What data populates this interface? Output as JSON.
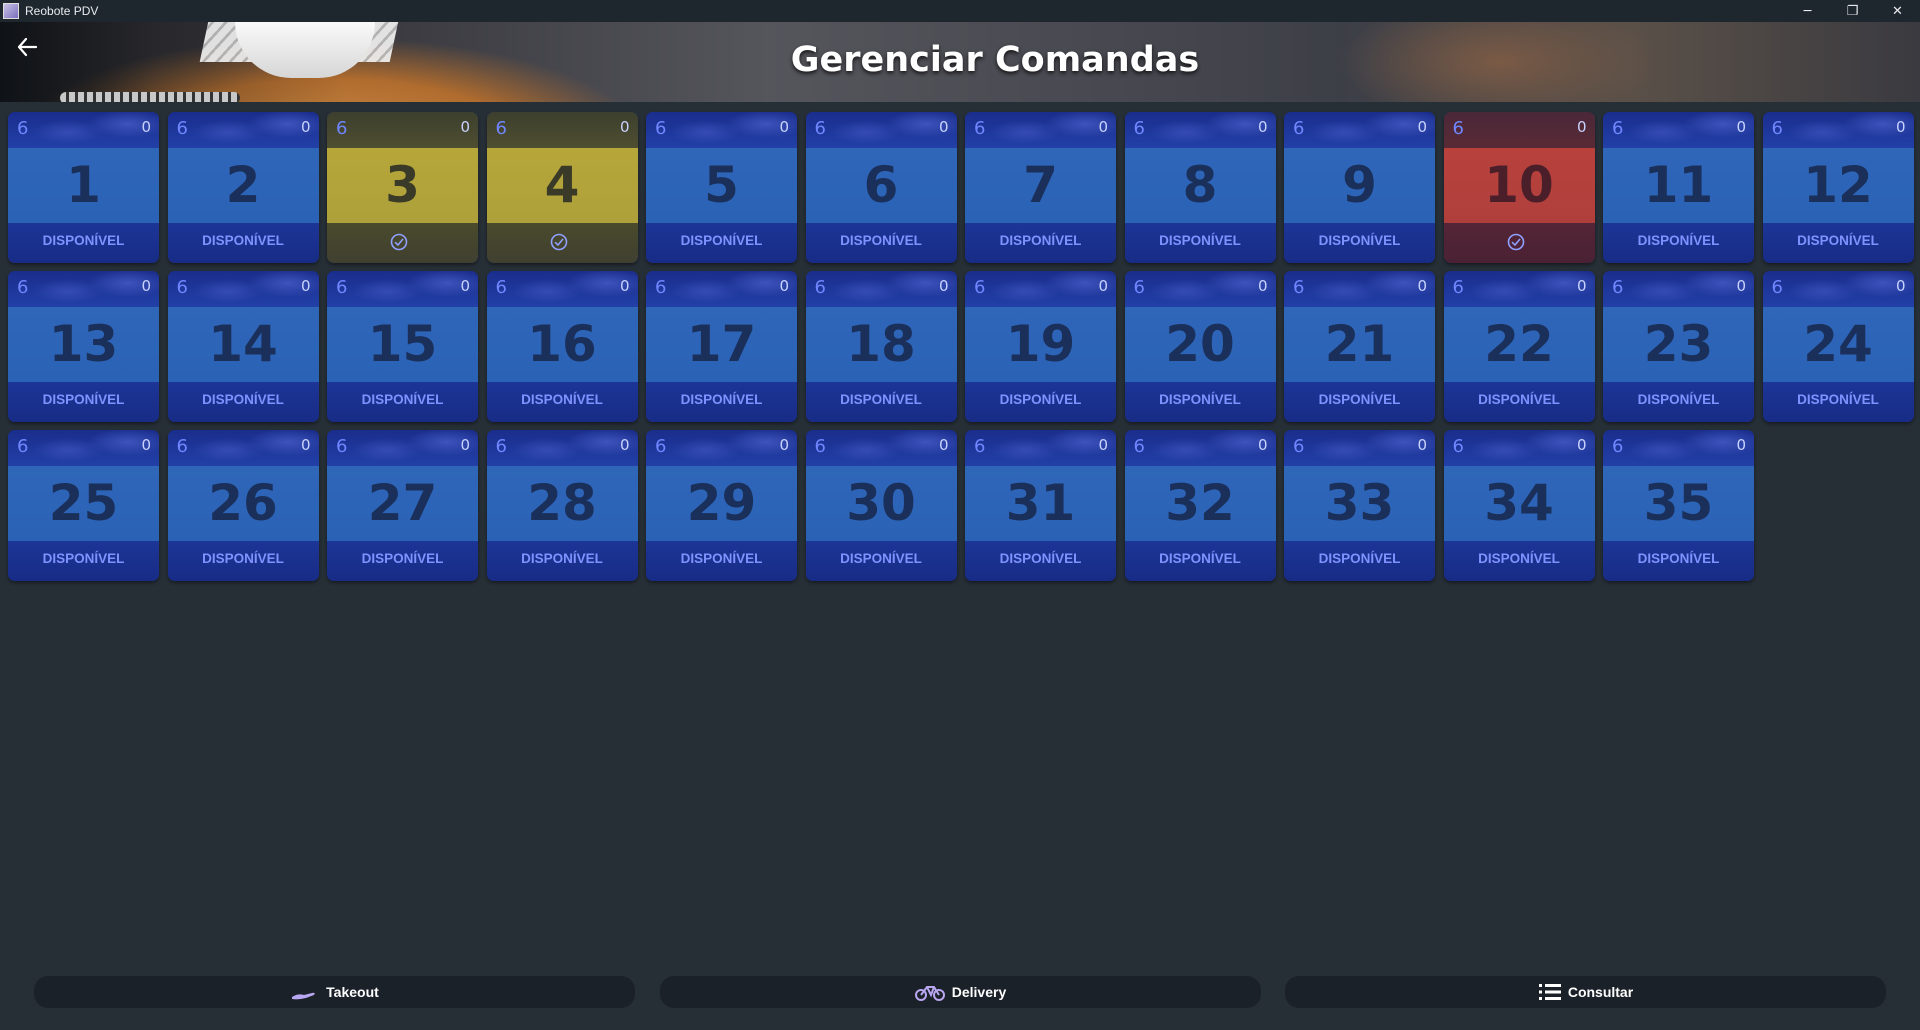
{
  "window": {
    "title": "Reobote PDV",
    "controls": {
      "minimize": "─",
      "restore": "❐",
      "close": "✕"
    }
  },
  "header": {
    "title": "Gerenciar Comandas",
    "back_icon": "arrow-left-icon"
  },
  "colors": {
    "available": "#2a62b6",
    "occupied_yellow": "#b6a73a",
    "occupied_red": "#b8413c"
  },
  "tiles": [
    {
      "number": "1",
      "seats": "6",
      "count": "0",
      "status": "DISPONÍVEL",
      "state": "available"
    },
    {
      "number": "2",
      "seats": "6",
      "count": "0",
      "status": "DISPONÍVEL",
      "state": "available"
    },
    {
      "number": "3",
      "seats": "6",
      "count": "0",
      "status": "",
      "state": "yellow"
    },
    {
      "number": "4",
      "seats": "6",
      "count": "0",
      "status": "",
      "state": "yellow"
    },
    {
      "number": "5",
      "seats": "6",
      "count": "0",
      "status": "DISPONÍVEL",
      "state": "available"
    },
    {
      "number": "6",
      "seats": "6",
      "count": "0",
      "status": "DISPONÍVEL",
      "state": "available"
    },
    {
      "number": "7",
      "seats": "6",
      "count": "0",
      "status": "DISPONÍVEL",
      "state": "available"
    },
    {
      "number": "8",
      "seats": "6",
      "count": "0",
      "status": "DISPONÍVEL",
      "state": "available"
    },
    {
      "number": "9",
      "seats": "6",
      "count": "0",
      "status": "DISPONÍVEL",
      "state": "available"
    },
    {
      "number": "10",
      "seats": "6",
      "count": "0",
      "status": "",
      "state": "red"
    },
    {
      "number": "11",
      "seats": "6",
      "count": "0",
      "status": "DISPONÍVEL",
      "state": "available"
    },
    {
      "number": "12",
      "seats": "6",
      "count": "0",
      "status": "DISPONÍVEL",
      "state": "available"
    },
    {
      "number": "13",
      "seats": "6",
      "count": "0",
      "status": "DISPONÍVEL",
      "state": "available"
    },
    {
      "number": "14",
      "seats": "6",
      "count": "0",
      "status": "DISPONÍVEL",
      "state": "available"
    },
    {
      "number": "15",
      "seats": "6",
      "count": "0",
      "status": "DISPONÍVEL",
      "state": "available"
    },
    {
      "number": "16",
      "seats": "6",
      "count": "0",
      "status": "DISPONÍVEL",
      "state": "available"
    },
    {
      "number": "17",
      "seats": "6",
      "count": "0",
      "status": "DISPONÍVEL",
      "state": "available"
    },
    {
      "number": "18",
      "seats": "6",
      "count": "0",
      "status": "DISPONÍVEL",
      "state": "available"
    },
    {
      "number": "19",
      "seats": "6",
      "count": "0",
      "status": "DISPONÍVEL",
      "state": "available"
    },
    {
      "number": "20",
      "seats": "6",
      "count": "0",
      "status": "DISPONÍVEL",
      "state": "available"
    },
    {
      "number": "21",
      "seats": "6",
      "count": "0",
      "status": "DISPONÍVEL",
      "state": "available"
    },
    {
      "number": "22",
      "seats": "6",
      "count": "0",
      "status": "DISPONÍVEL",
      "state": "available"
    },
    {
      "number": "23",
      "seats": "6",
      "count": "0",
      "status": "DISPONÍVEL",
      "state": "available"
    },
    {
      "number": "24",
      "seats": "6",
      "count": "0",
      "status": "DISPONÍVEL",
      "state": "available"
    },
    {
      "number": "25",
      "seats": "6",
      "count": "0",
      "status": "DISPONÍVEL",
      "state": "available"
    },
    {
      "number": "26",
      "seats": "6",
      "count": "0",
      "status": "DISPONÍVEL",
      "state": "available"
    },
    {
      "number": "27",
      "seats": "6",
      "count": "0",
      "status": "DISPONÍVEL",
      "state": "available"
    },
    {
      "number": "28",
      "seats": "6",
      "count": "0",
      "status": "DISPONÍVEL",
      "state": "available"
    },
    {
      "number": "29",
      "seats": "6",
      "count": "0",
      "status": "DISPONÍVEL",
      "state": "available"
    },
    {
      "number": "30",
      "seats": "6",
      "count": "0",
      "status": "DISPONÍVEL",
      "state": "available"
    },
    {
      "number": "31",
      "seats": "6",
      "count": "0",
      "status": "DISPONÍVEL",
      "state": "available"
    },
    {
      "number": "32",
      "seats": "6",
      "count": "0",
      "status": "DISPONÍVEL",
      "state": "available"
    },
    {
      "number": "33",
      "seats": "6",
      "count": "0",
      "status": "DISPONÍVEL",
      "state": "available"
    },
    {
      "number": "34",
      "seats": "6",
      "count": "0",
      "status": "DISPONÍVEL",
      "state": "available"
    },
    {
      "number": "35",
      "seats": "6",
      "count": "0",
      "status": "DISPONÍVEL",
      "state": "available"
    }
  ],
  "footer": {
    "takeout_label": "Takeout",
    "takeout_icon": "hand-icon",
    "delivery_label": "Delivery",
    "delivery_icon": "bicycle-icon",
    "consult_label": "Consultar",
    "consult_icon": "list-icon"
  }
}
